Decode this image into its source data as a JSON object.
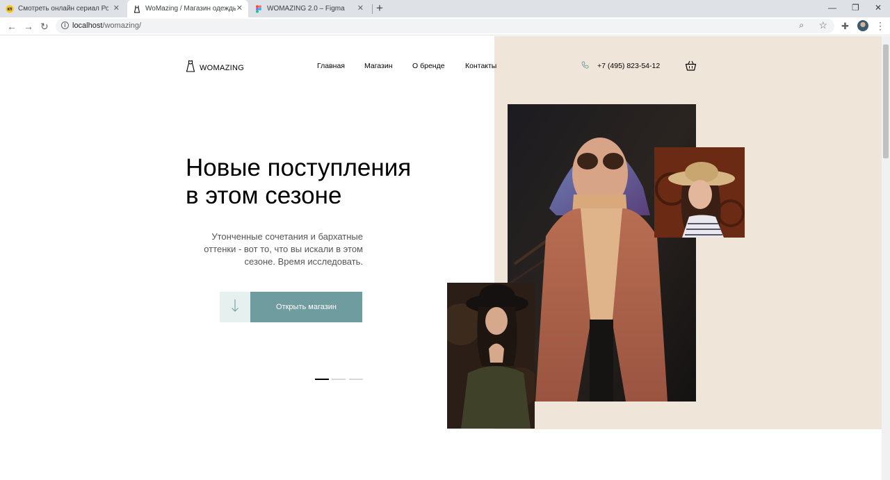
{
  "browser": {
    "tabs": [
      {
        "title": "Смотреть онлайн сериал Родко",
        "icon": "kinopoisk-icon"
      },
      {
        "title": "WoMazing / Магазин одежды",
        "icon": "dress-icon"
      },
      {
        "title": "WOMAZING 2.0 – Figma",
        "icon": "figma-icon"
      }
    ],
    "url_host": "localhost",
    "url_path": "/womazing/"
  },
  "header": {
    "logo_text": "WOMAZING",
    "nav": [
      "Главная",
      "Магазин",
      "О бренде",
      "Контакты"
    ],
    "phone": "+7 (495) 823-54-12"
  },
  "hero": {
    "title_line1": "Новые поступления",
    "title_line2": "в этом сезоне",
    "subtitle": "Утонченные сочетания и бархатные оттенки - вот то, что вы искали в этом сезоне. Время исследовать.",
    "button_label": "Открыть магазин",
    "slider_active": 1,
    "slider_count": 3
  },
  "colors": {
    "accent": "#6e9c9f",
    "beige": "#efe5d9",
    "arrow_bg": "#e6f0ef"
  }
}
